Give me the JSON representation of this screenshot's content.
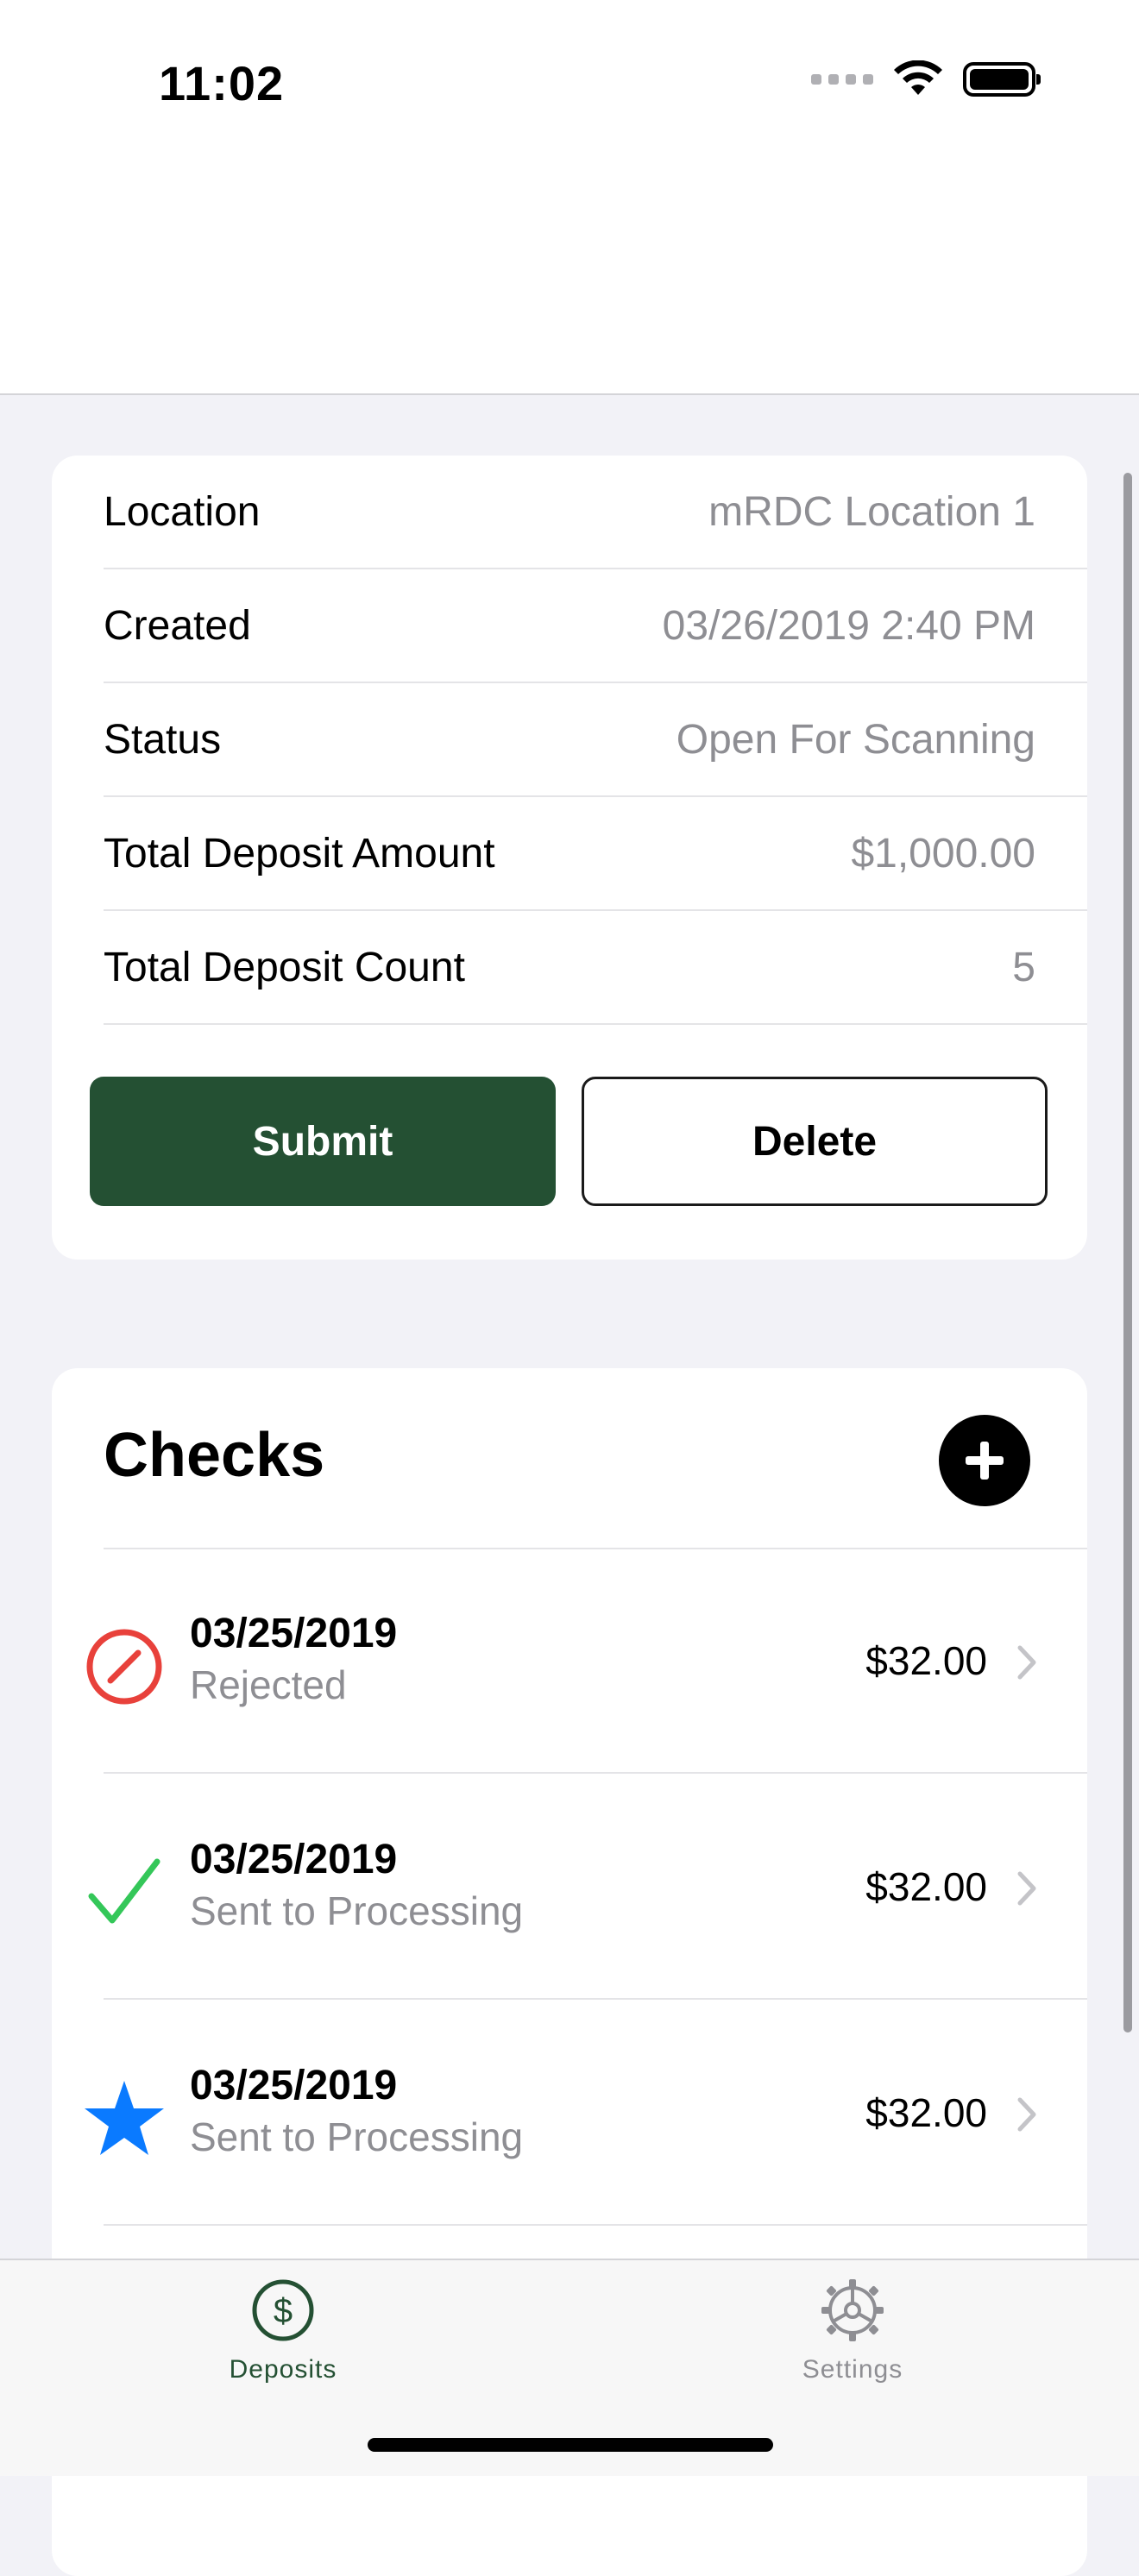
{
  "status_bar": {
    "time": "11:02"
  },
  "details": {
    "rows": [
      {
        "label": "Location",
        "value": "mRDC Location 1"
      },
      {
        "label": "Created",
        "value": "03/26/2019 2:40 PM"
      },
      {
        "label": "Status",
        "value": "Open For Scanning"
      },
      {
        "label": "Total Deposit Amount",
        "value": "$1,000.00"
      },
      {
        "label": "Total Deposit Count",
        "value": "5"
      }
    ],
    "submit_label": "Submit",
    "delete_label": "Delete"
  },
  "checks": {
    "title": "Checks",
    "items": [
      {
        "date": "03/25/2019",
        "status": "Rejected",
        "amount": "$32.00",
        "icon": "rejected-icon"
      },
      {
        "date": "03/25/2019",
        "status": "Sent to Processing",
        "amount": "$32.00",
        "icon": "checkmark-icon"
      },
      {
        "date": "03/25/2019",
        "status": "Sent to Processing",
        "amount": "$32.00",
        "icon": "star-icon"
      }
    ]
  },
  "tabbar": {
    "tabs": [
      {
        "label": "Deposits",
        "icon": "dollar-circle-icon",
        "active": true
      },
      {
        "label": "Settings",
        "icon": "gear-icon",
        "active": false
      }
    ]
  },
  "colors": {
    "brand_green": "#245033",
    "rejected_red": "#e8413b",
    "success_green": "#34c759",
    "star_blue": "#0a7aff"
  }
}
